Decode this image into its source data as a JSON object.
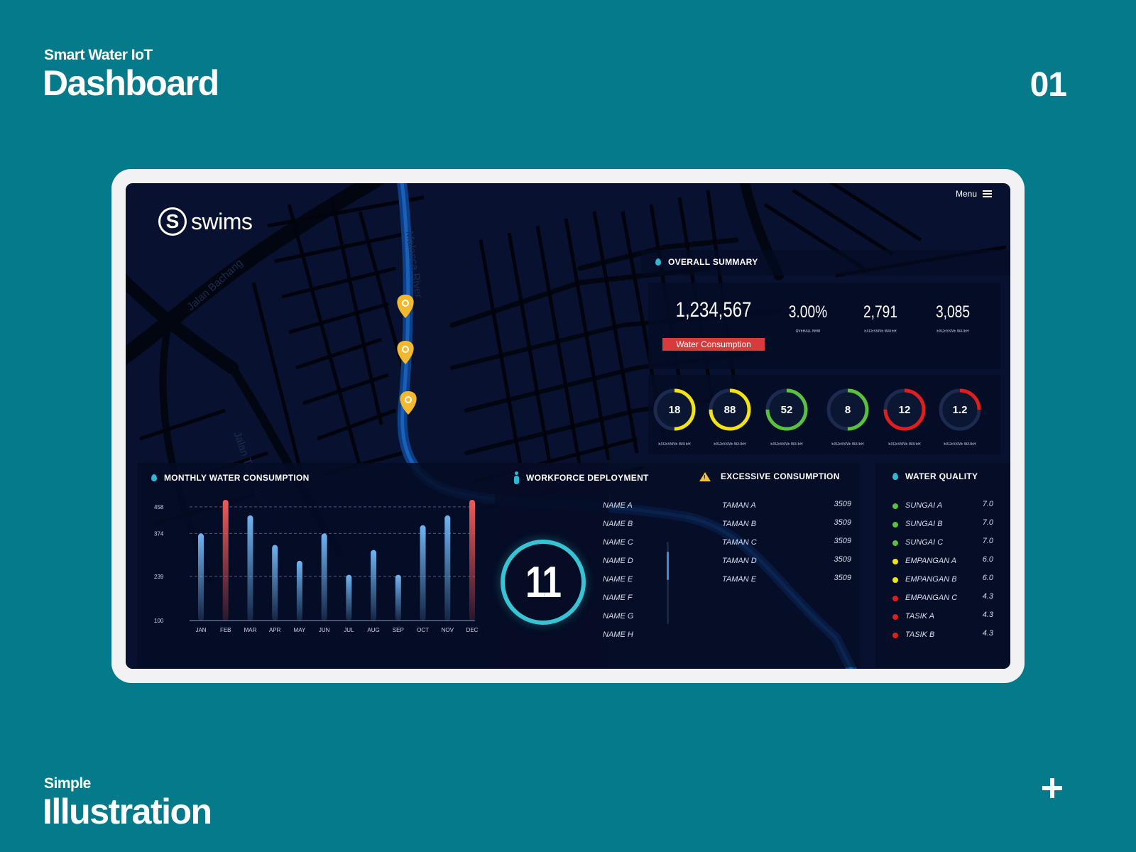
{
  "page": {
    "subtitle": "Smart Water IoT",
    "title": "Dashboard",
    "number": "01",
    "footer_subtitle": "Simple",
    "footer_title": "Illustration"
  },
  "app": {
    "logo_letter": "S",
    "logo_text": "swims",
    "menu_label": "Menu"
  },
  "map": {
    "labels": [
      "Jalan Bachang",
      "Malacca River",
      "Jalan Tun Fatimah",
      "Malacca River"
    ],
    "pins": 3
  },
  "summary": {
    "title": "OVERALL SUMMARY",
    "main_value": "1,234,567",
    "main_badge": "Water Consumption",
    "stats": [
      {
        "value": "3.00%",
        "caption": "OVERALL NRW"
      },
      {
        "value": "2,791",
        "caption": "EXCESSIVE WATER"
      },
      {
        "value": "3,085",
        "caption": "EXCESSIVE WATER"
      }
    ],
    "gauges": [
      {
        "value": "18",
        "percent": 50,
        "color": "#f2e313",
        "caption": "EXCESSIVE WATER"
      },
      {
        "value": "88",
        "percent": 75,
        "color": "#f2e313",
        "caption": "EXCESSIVE WATER"
      },
      {
        "value": "52",
        "percent": 75,
        "color": "#5ac13e",
        "caption": "EXCESSIVE WATER"
      },
      {
        "value": "8",
        "percent": 50,
        "color": "#5ac13e",
        "caption": "EXCESSIVE WATER"
      },
      {
        "value": "12",
        "percent": 75,
        "color": "#e01e1e",
        "caption": "EXCESSIVE WATER"
      },
      {
        "value": "1.2",
        "percent": 25,
        "color": "#e01e1e",
        "caption": "EXCESSIVE WATER"
      }
    ]
  },
  "monthly": {
    "title": "MONTHLY WATER CONSUMPTION"
  },
  "chart_data": {
    "type": "bar",
    "title": "MONTHLY WATER CONSUMPTION",
    "categories": [
      "JAN",
      "FEB",
      "MAR",
      "APR",
      "MAY",
      "JUN",
      "JUL",
      "AUG",
      "SEP",
      "OCT",
      "NOV",
      "DEC"
    ],
    "values": [
      374,
      480,
      431,
      338,
      288,
      374,
      244,
      322,
      244,
      400,
      431,
      480
    ],
    "highlight": [
      false,
      true,
      false,
      false,
      false,
      false,
      false,
      false,
      false,
      false,
      false,
      true
    ],
    "yticks": [
      100,
      239,
      374,
      458
    ],
    "ylim": [
      100,
      480
    ],
    "grid": true,
    "bar_color": "#6fb4f2",
    "highlight_color": "#ee5a5a"
  },
  "workforce": {
    "title": "WORKFORCE DEPLOYMENT",
    "count": "11",
    "names": [
      "NAME A",
      "NAME B",
      "NAME C",
      "NAME D",
      "NAME E",
      "NAME F",
      "NAME G",
      "NAME H"
    ]
  },
  "excessive": {
    "title": "EXCESSIVE CONSUMPTION",
    "rows": [
      {
        "name": "TAMAN A",
        "value": "3509"
      },
      {
        "name": "TAMAN B",
        "value": "3509"
      },
      {
        "name": "TAMAN C",
        "value": "3509"
      },
      {
        "name": "TAMAN D",
        "value": "3509"
      },
      {
        "name": "TAMAN E",
        "value": "3509"
      }
    ]
  },
  "quality": {
    "title": "WATER QUALITY",
    "rows": [
      {
        "name": "SUNGAI A",
        "value": "7.0",
        "status": "good",
        "color": "#5ac13e"
      },
      {
        "name": "SUNGAI B",
        "value": "7.0",
        "status": "good",
        "color": "#5ac13e"
      },
      {
        "name": "SUNGAI C",
        "value": "7.0",
        "status": "good",
        "color": "#5ac13e"
      },
      {
        "name": "EMPANGAN A",
        "value": "6.0",
        "status": "warning",
        "color": "#f2e313"
      },
      {
        "name": "EMPANGAN B",
        "value": "6.0",
        "status": "warning",
        "color": "#f2e313"
      },
      {
        "name": "EMPANGAN C",
        "value": "4.3",
        "status": "bad",
        "color": "#e01e1e"
      },
      {
        "name": "TASIK A",
        "value": "4.3",
        "status": "bad",
        "color": "#e01e1e"
      },
      {
        "name": "TASIK B",
        "value": "4.3",
        "status": "bad",
        "color": "#e01e1e"
      }
    ]
  }
}
